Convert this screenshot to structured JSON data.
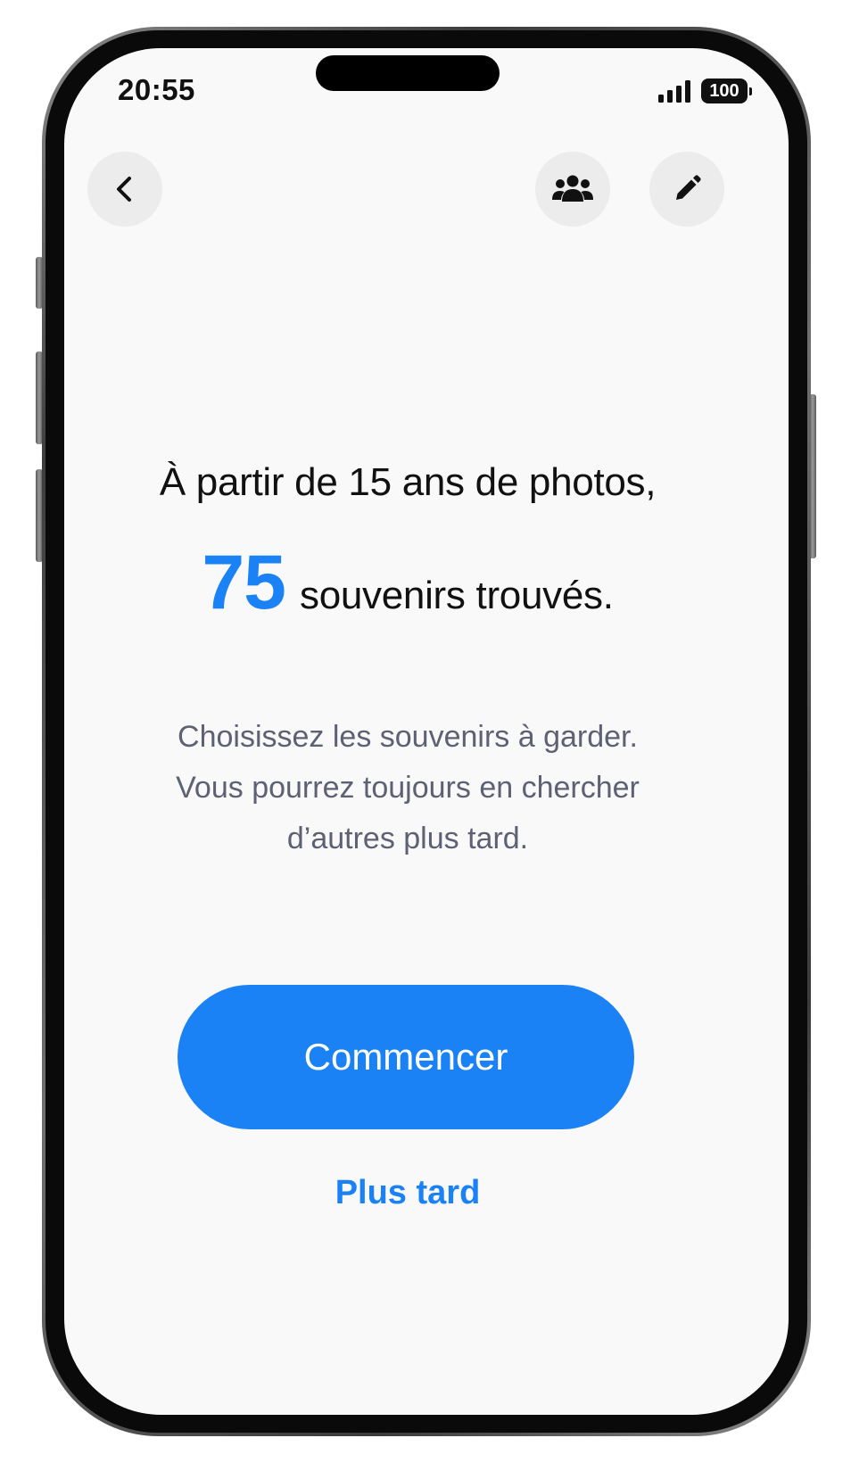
{
  "status_bar": {
    "time": "20:55",
    "battery": "100",
    "signal_bars": 4
  },
  "nav": {
    "back_icon": "chevron-left-icon",
    "group_icon": "people-icon",
    "edit_icon": "pencil-icon"
  },
  "content": {
    "headline": "À partir de 15 ans de photos,",
    "count": "75",
    "count_label": "souvenirs trouvés.",
    "description_lines": [
      "Choisissez les souvenirs à garder.",
      "Vous pourrez toujours en chercher",
      "d’autres plus tard."
    ]
  },
  "actions": {
    "primary_label": "Commencer",
    "secondary_label": "Plus tard"
  },
  "colors": {
    "accent": "#1a82f5",
    "background": "#f9f9f9",
    "secondary_text": "#5e6073",
    "button_bg": "#ececec"
  }
}
